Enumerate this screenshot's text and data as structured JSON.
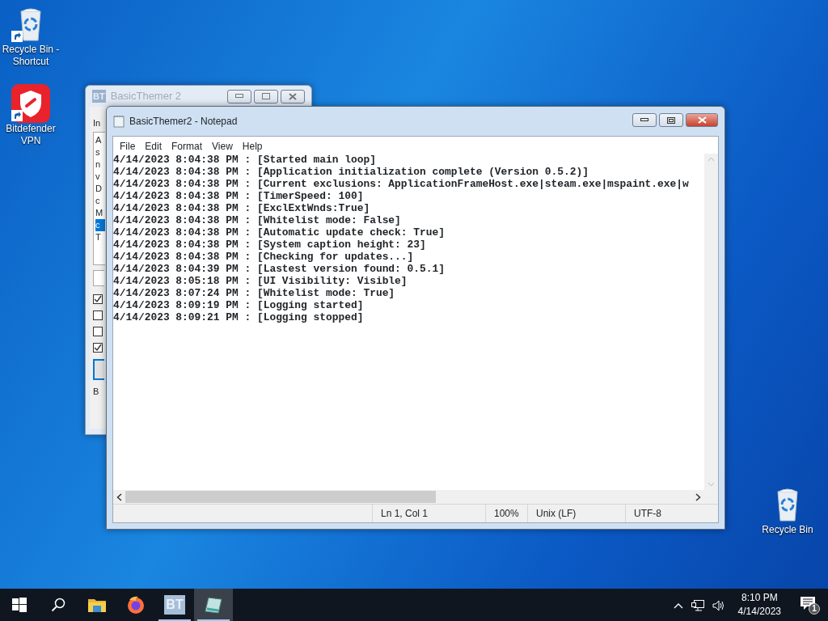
{
  "desktop_icons": [
    {
      "label": "Recycle Bin - Shortcut",
      "kind": "recycle",
      "shortcut": true
    },
    {
      "label": "Bitdefender VPN",
      "kind": "vpn",
      "shortcut": true
    },
    {
      "label": "Recycle Bin",
      "kind": "recycle",
      "shortcut": false
    }
  ],
  "back_window": {
    "title": "BasicThemer 2",
    "icon_text": "BT",
    "label": "In",
    "list_items": [
      {
        "text": "A",
        "selected": false
      },
      {
        "text": "s",
        "selected": false
      },
      {
        "text": "n",
        "selected": false
      },
      {
        "text": "v",
        "selected": false
      },
      {
        "text": "D",
        "selected": false
      },
      {
        "text": "c",
        "selected": false
      },
      {
        "text": "M",
        "selected": false
      },
      {
        "text": "c",
        "selected": true
      },
      {
        "text": "T",
        "selected": false
      }
    ],
    "checkboxes": [
      {
        "checked": true
      },
      {
        "checked": false
      },
      {
        "checked": false
      },
      {
        "checked": true
      }
    ],
    "footer": "B"
  },
  "notepad": {
    "title": "BasicThemer2 - Notepad",
    "menu": [
      "File",
      "Edit",
      "Format",
      "View",
      "Help"
    ],
    "lines": [
      "4/14/2023 8:04:38 PM : [Started main loop]",
      "4/14/2023 8:04:38 PM : [Application initialization complete (Version 0.5.2)]",
      "4/14/2023 8:04:38 PM : [Current exclusions: ApplicationFrameHost.exe|steam.exe|mspaint.exe|w",
      "4/14/2023 8:04:38 PM : [TimerSpeed: 100]",
      "4/14/2023 8:04:38 PM : [ExclExtWnds:True]",
      "4/14/2023 8:04:38 PM : [Whitelist mode: False]",
      "4/14/2023 8:04:38 PM : [Automatic update check: True]",
      "4/14/2023 8:04:38 PM : [System caption height: 23]",
      "4/14/2023 8:04:38 PM : [Checking for updates...]",
      "4/14/2023 8:04:39 PM : [Lastest version found: 0.5.1]",
      "4/14/2023 8:05:18 PM : [UI Visibility: Visible]",
      "4/14/2023 8:07:24 PM : [Whitelist mode: True]",
      "4/14/2023 8:09:19 PM : [Logging started]",
      "4/14/2023 8:09:21 PM : [Logging stopped]"
    ],
    "status_bar": [
      "Ln 1, Col 1",
      "100%",
      "Unix (LF)",
      "UTF-8"
    ]
  },
  "taskbar": {
    "items": [
      {
        "kind": "start",
        "running": false,
        "selected": false
      },
      {
        "kind": "search",
        "running": false,
        "selected": false
      },
      {
        "kind": "explorer",
        "running": false,
        "selected": false
      },
      {
        "kind": "firefox",
        "running": false,
        "selected": false
      },
      {
        "kind": "basicthemer",
        "label": "BT",
        "running": true,
        "selected": false
      },
      {
        "kind": "notepad",
        "running": true,
        "selected": true
      }
    ],
    "clock_time": "8:10 PM",
    "clock_date": "4/14/2023",
    "notification_count": "1"
  }
}
